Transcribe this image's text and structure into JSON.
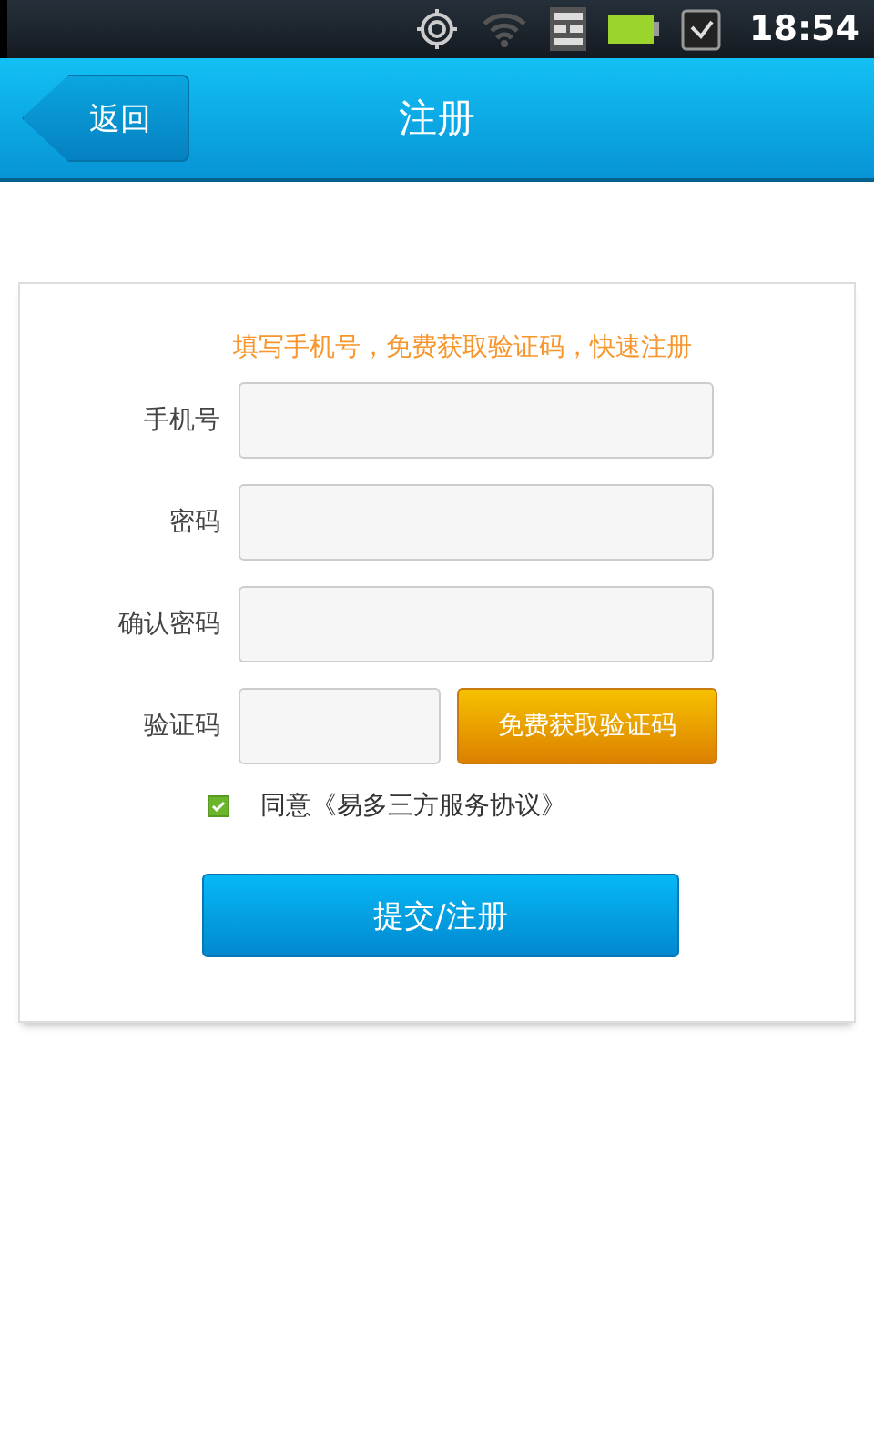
{
  "status_bar": {
    "time": "18:54"
  },
  "header": {
    "back": "返回",
    "title": "注册"
  },
  "form": {
    "hint": "填写手机号，免费获取验证码，快速注册",
    "fields": [
      {
        "kind": "text",
        "label": "手机号"
      },
      {
        "kind": "text",
        "label": "密码"
      },
      {
        "kind": "text",
        "label": "确认密码"
      },
      {
        "kind": "code",
        "label": "验证码",
        "button": "免费获取验证码"
      }
    ],
    "agreement": {
      "checked": true,
      "text": "同意《易多三方服务协议》"
    },
    "submit": "提交/注册"
  }
}
